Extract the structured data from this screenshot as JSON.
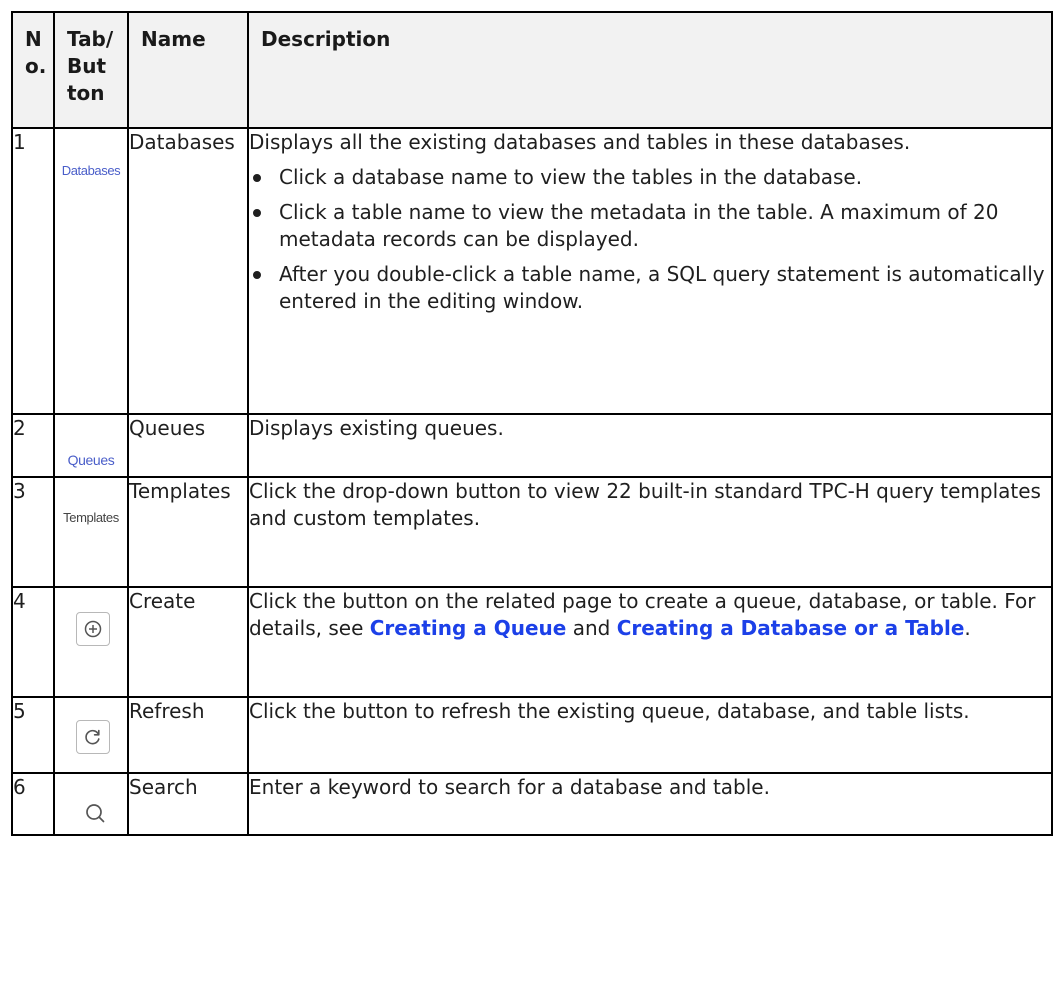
{
  "table": {
    "headers": {
      "no": "No.",
      "tab": "Tab/ Button",
      "name": "Name",
      "description": "Description"
    },
    "rows": [
      {
        "no": "1",
        "tab_label": "Databases",
        "name": "Databases",
        "description": "Displays all the existing databases and tables in these databases.",
        "bullets": [
          "Click a database name to view the tables in the database.",
          "Click a table name to view the metadata in the table. A maximum of 20 metadata records can be displayed.",
          "After you double-click a table name, a SQL query statement is automatically entered in the editing window."
        ]
      },
      {
        "no": "2",
        "tab_label": "Queues",
        "name": "Queues",
        "description": "Displays existing queues."
      },
      {
        "no": "3",
        "tab_label": "Templates",
        "name": "Templates",
        "description": "Click the drop-down button to view 22 built-in standard TPC-H query templates and custom templates."
      },
      {
        "no": "4",
        "icon": "create-icon",
        "name": "Create",
        "description_prefix": "Click the button on the related page to create a queue, database, or table. For details, see ",
        "link1": "Creating a Queue",
        "description_mid": " and ",
        "link2": "Creating a Database or a Table",
        "description_suffix": "."
      },
      {
        "no": "5",
        "icon": "refresh-icon",
        "name": "Refresh",
        "description": "Click the button to refresh the existing queue, database, and table lists."
      },
      {
        "no": "6",
        "icon": "search-icon",
        "name": "Search",
        "description": "Enter a keyword to search for a database and table."
      }
    ]
  },
  "colors": {
    "link": "#1c40e8",
    "tab_label": "#4a5ec9",
    "header_bg": "#f2f2f2"
  }
}
